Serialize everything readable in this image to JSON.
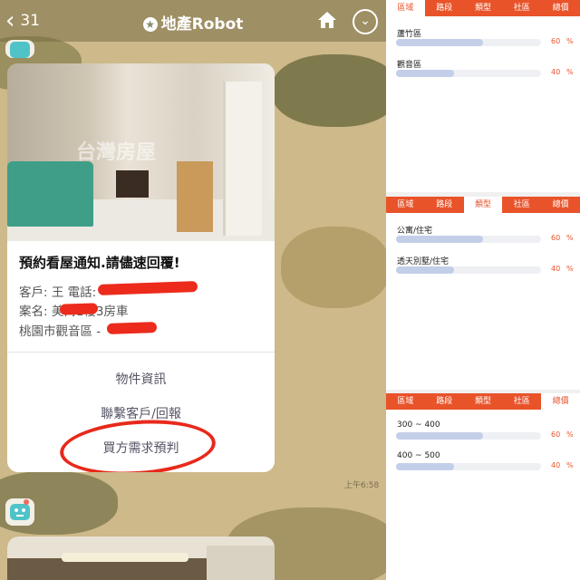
{
  "chat": {
    "header": {
      "back_count": "31",
      "title": "地產Robot"
    },
    "card": {
      "title": "預約看屋通知.請儘速回覆!",
      "lines": [
        "客戶: 王 電話:",
        "案名: 美寓1樓3房車",
        "桃園市觀音區 -"
      ],
      "watermark": "台灣房屋",
      "actions": [
        "物件資訊",
        "聯繫客戶/回報",
        "買方需求預判"
      ]
    },
    "timestamp": "上午6:58"
  },
  "panels": [
    {
      "tabs": [
        "區域",
        "路段",
        "類型",
        "社區",
        "總價"
      ],
      "active_tab": 0,
      "rows": [
        {
          "label": "蘆竹區",
          "value": 60,
          "unit": "%"
        },
        {
          "label": "觀音區",
          "value": 40,
          "unit": "%"
        }
      ]
    },
    {
      "tabs": [
        "區域",
        "路段",
        "類型",
        "社區",
        "總價"
      ],
      "active_tab": 2,
      "rows": [
        {
          "label": "公寓/住宅",
          "value": 60,
          "unit": "%"
        },
        {
          "label": "透天別墅/住宅",
          "value": 40,
          "unit": "%"
        }
      ]
    },
    {
      "tabs": [
        "區域",
        "路段",
        "類型",
        "社區",
        "總價"
      ],
      "active_tab": 4,
      "rows": [
        {
          "label": "300 ~ 400",
          "value": 60,
          "unit": "%"
        },
        {
          "label": "400 ~ 500",
          "value": 40,
          "unit": "%"
        }
      ]
    }
  ],
  "colors": {
    "accent": "#e9532a",
    "bar_fill": "#c3cfe8",
    "redaction": "#ec2b1c"
  }
}
